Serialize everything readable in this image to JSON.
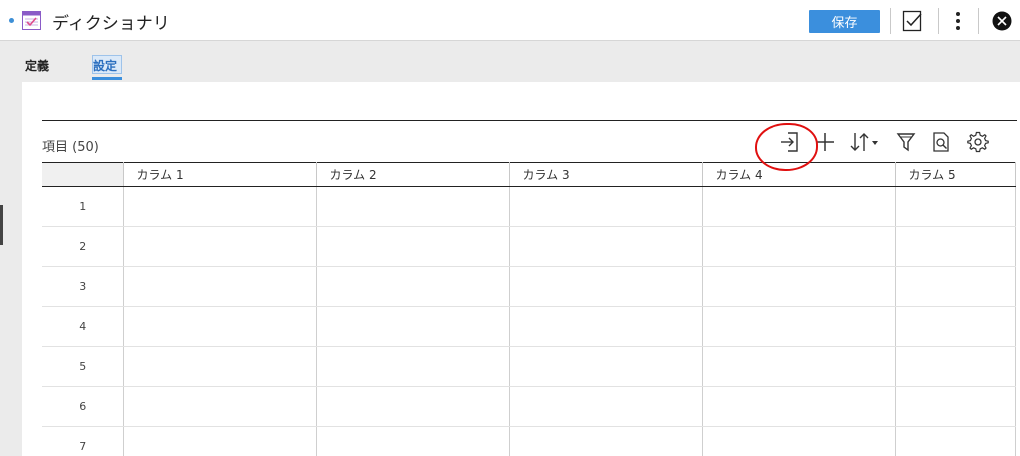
{
  "window": {
    "title": "ディクショナリ",
    "save_label": "保存",
    "accent_color": "#3b8fdd",
    "icons": [
      "dictionary-app-icon",
      "checklist-icon",
      "more-vertical-icon",
      "close-circle-icon"
    ]
  },
  "tabs": [
    {
      "label": "定義",
      "selected": false
    },
    {
      "label": "設定",
      "selected": true
    }
  ],
  "items": {
    "label": "項目 (50)"
  },
  "toolbar": {
    "icons": [
      "import-icon",
      "add-icon",
      "sort-icon",
      "filter-icon",
      "find-icon",
      "settings-icon"
    ]
  },
  "grid": {
    "columns": [
      "カラム 1",
      "カラム 2",
      "カラム 3",
      "カラム 4",
      "カラム 5"
    ],
    "rows": [
      "1",
      "2",
      "3",
      "4",
      "5",
      "6",
      "7"
    ]
  }
}
